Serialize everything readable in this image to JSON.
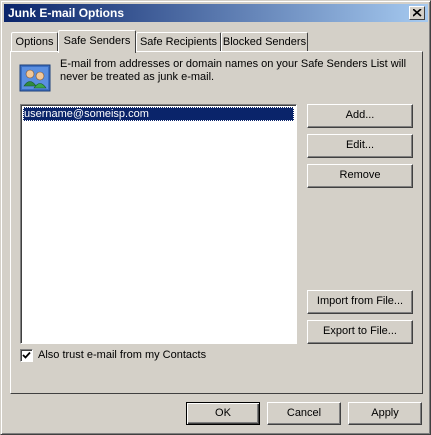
{
  "window": {
    "title": "Junk E-mail Options"
  },
  "tabs": [
    {
      "label": "Options",
      "active": false
    },
    {
      "label": "Safe Senders",
      "active": true
    },
    {
      "label": "Safe Recipients",
      "active": false
    },
    {
      "label": "Blocked Senders",
      "active": false
    }
  ],
  "info": {
    "icon": "contacts-icon",
    "text": "E-mail from addresses or domain names on your Safe Senders List will never be treated as junk e-mail."
  },
  "list": {
    "items": [
      "username@someisp.com"
    ],
    "selected_index": 0
  },
  "side_buttons": {
    "add": "Add...",
    "edit": "Edit...",
    "remove": "Remove",
    "import": "Import from File...",
    "export": "Export to File..."
  },
  "trust_contacts": {
    "label": "Also trust e-mail from my Contacts",
    "checked": true
  },
  "dialog_buttons": {
    "ok": "OK",
    "cancel": "Cancel",
    "apply": "Apply"
  },
  "colors": {
    "title_start": "#0a246a",
    "title_end": "#a6caf0",
    "selection": "#0a246a",
    "face": "#d4d0c8"
  }
}
